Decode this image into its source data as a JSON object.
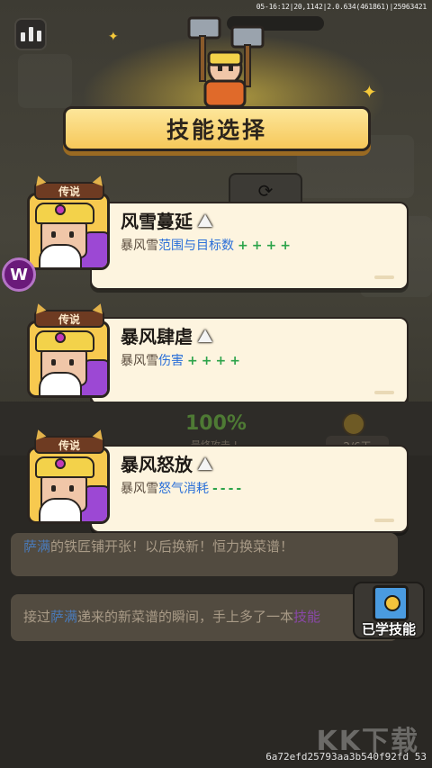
{
  "status_bar": {
    "text": "05-16:12|20,1142|2.0.634(461861)|25963421"
  },
  "header": {
    "title": "技能选择"
  },
  "cards": [
    {
      "rarity": "传说",
      "name": "风雪蔓延",
      "desc_prefix": "暴风雪",
      "desc_highlight": "范围与目标数",
      "modifier": "++++"
    },
    {
      "rarity": "传说",
      "name": "暴风肆虐",
      "desc_prefix": "暴风雪",
      "desc_highlight": "伤害",
      "modifier": "++++"
    },
    {
      "rarity": "传说",
      "name": "暴风怒放",
      "desc_prefix": "暴风雪",
      "desc_highlight": "怒气消耗",
      "modifier": "----"
    }
  ],
  "badges": {
    "w_badge": "W"
  },
  "background": {
    "percent": "100%",
    "percent_label": "最终攻击 !",
    "day_counter": "2/6天",
    "messages": [
      {
        "name": "萨满",
        "text": "的铁匠铺开张！以后换新！恒力换菜谱！"
      },
      {
        "pre": "接过",
        "name": "萨满",
        "mid": "递来的新菜谱的瞬间，手上多了一本",
        "skill": "技能"
      }
    ]
  },
  "learned_button": {
    "label": "已学技能"
  },
  "watermark": "KK下载",
  "session_id": "6a72efd25793aa3b540f92fd 53",
  "colors": {
    "highlight_blue": "#2a6fd8",
    "modifier_green": "#2ca34a",
    "banner_gold": "#f6c85a"
  }
}
